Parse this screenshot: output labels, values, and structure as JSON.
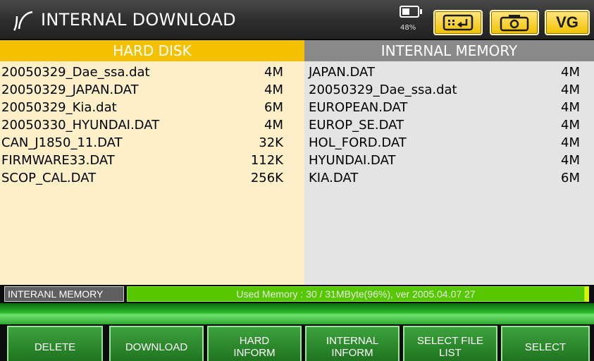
{
  "titlebar": {
    "title": "INTERNAL DOWNLOAD",
    "battery_percent": "48%",
    "vg_label": "VG",
    "icons": [
      "logo-icon",
      "battery-icon",
      "keyboard-enter-icon",
      "camera-icon"
    ]
  },
  "hard_disk": {
    "header": "HARD DISK",
    "files": [
      {
        "name": "20050329_Dae_ssa.dat",
        "size": "4M"
      },
      {
        "name": "20050329_JAPAN.DAT",
        "size": "4M"
      },
      {
        "name": "20050329_Kia.dat",
        "size": "6M"
      },
      {
        "name": "20050330_HYUNDAI.DAT",
        "size": "4M"
      },
      {
        "name": "CAN_J1850_11.DAT",
        "size": "32K"
      },
      {
        "name": "FIRMWARE33.DAT",
        "size": "112K"
      },
      {
        "name": "SCOP_CAL.DAT",
        "size": "256K"
      }
    ]
  },
  "internal_memory": {
    "header": "INTERNAL MEMORY",
    "files": [
      {
        "name": "JAPAN.DAT",
        "size": "4M"
      },
      {
        "name": "20050329_Dae_ssa.dat",
        "size": "4M"
      },
      {
        "name": "EUROPEAN.DAT",
        "size": "4M"
      },
      {
        "name": "EUROP_SE.DAT",
        "size": "4M"
      },
      {
        "name": "HOL_FORD.DAT",
        "size": "4M"
      },
      {
        "name": "HYUNDAI.DAT",
        "size": "4M"
      },
      {
        "name": "KIA.DAT",
        "size": "6M"
      }
    ]
  },
  "status": {
    "label": "INTERANL MEMORY",
    "message": "Used Memory : 30 / 31MByte(96%), ver 2005.04.07 27"
  },
  "buttons": {
    "delete": "DELETE",
    "download": "DOWNLOAD",
    "hard_inform": "HARD\nINFORM",
    "internal_inform": "INTERNAL\nINFORM",
    "select_file_list": "SELECT FILE\nLIST",
    "select": "SELECT"
  },
  "colors": {
    "hard_disk_header": "#f5c000",
    "hard_disk_pane": "#fdf0c8",
    "internal_memory_header": "#8a8a8a",
    "internal_memory_pane": "#e4e4e4",
    "status_green": "#55c800",
    "button_green": "#2f8f2f"
  }
}
